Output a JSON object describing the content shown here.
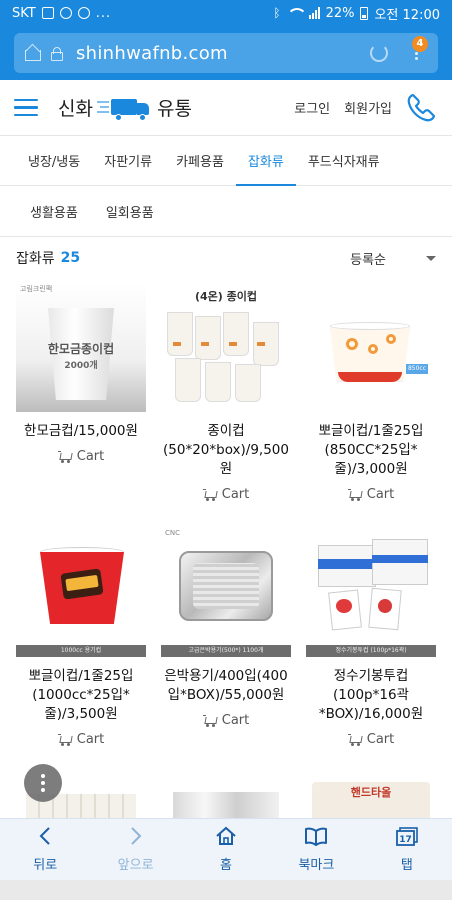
{
  "status_bar": {
    "carrier": "SKT",
    "more": "...",
    "battery": "22%",
    "time": "오전 12:00"
  },
  "browser": {
    "url": "shinhwafnb.com",
    "tab_count": "4"
  },
  "header": {
    "logo_left": "신화",
    "logo_right": "유통",
    "login": "로그인",
    "signup": "회원가입",
    "brand_color": "#1a88dc"
  },
  "category_menu": {
    "items": [
      "냉장/냉동",
      "자판기류",
      "카페용품",
      "잡화류",
      "푸드식자재류"
    ],
    "active": "잡화류"
  },
  "sub_menu": {
    "items": [
      "생활용품",
      "일회용품"
    ]
  },
  "list": {
    "category": "잡화류",
    "count": "25",
    "sort": "등록순"
  },
  "products": [
    {
      "name": "한모금컵/15,000원",
      "cart": "Cart",
      "thumb_tag": "고림크린팩",
      "thumb_text": "한모금종이컵",
      "thumb_sub": "2000개"
    },
    {
      "name": "종이컵(50*20*box)/9,500원",
      "cart": "Cart",
      "thumb_text": "(4온) 종이컵"
    },
    {
      "name": "뽀글이컵/1줄25입(850CC*25입*줄)/3,000원",
      "cart": "Cart",
      "thumb_tag": "850cc"
    },
    {
      "name": "뽀글이컵/1줄25입(1000cc*25입*줄)/3,500원",
      "cart": "Cart",
      "thumb_strip": "1000cc 용기컵"
    },
    {
      "name": "은박용기/400입(400입*BOX)/55,000원",
      "cart": "Cart",
      "thumb_tag": "CNC",
      "thumb_strip": "고급은박용기(500*) 1100개"
    },
    {
      "name": "정수기봉투컵(100p*16곽*BOX)/16,000원",
      "cart": "Cart",
      "thumb_strip": "정수기봉투컵 (100p*16곽)"
    },
    {
      "name": "",
      "cart": ""
    },
    {
      "name": "",
      "cart": ""
    },
    {
      "name": "",
      "cart": "",
      "thumb_text": "핸드타올"
    }
  ],
  "bottom_nav": {
    "back": "뒤로",
    "forward": "앞으로",
    "home": "홈",
    "bookmark": "북마크",
    "tabs": "탭",
    "tabs_badge": "17"
  }
}
